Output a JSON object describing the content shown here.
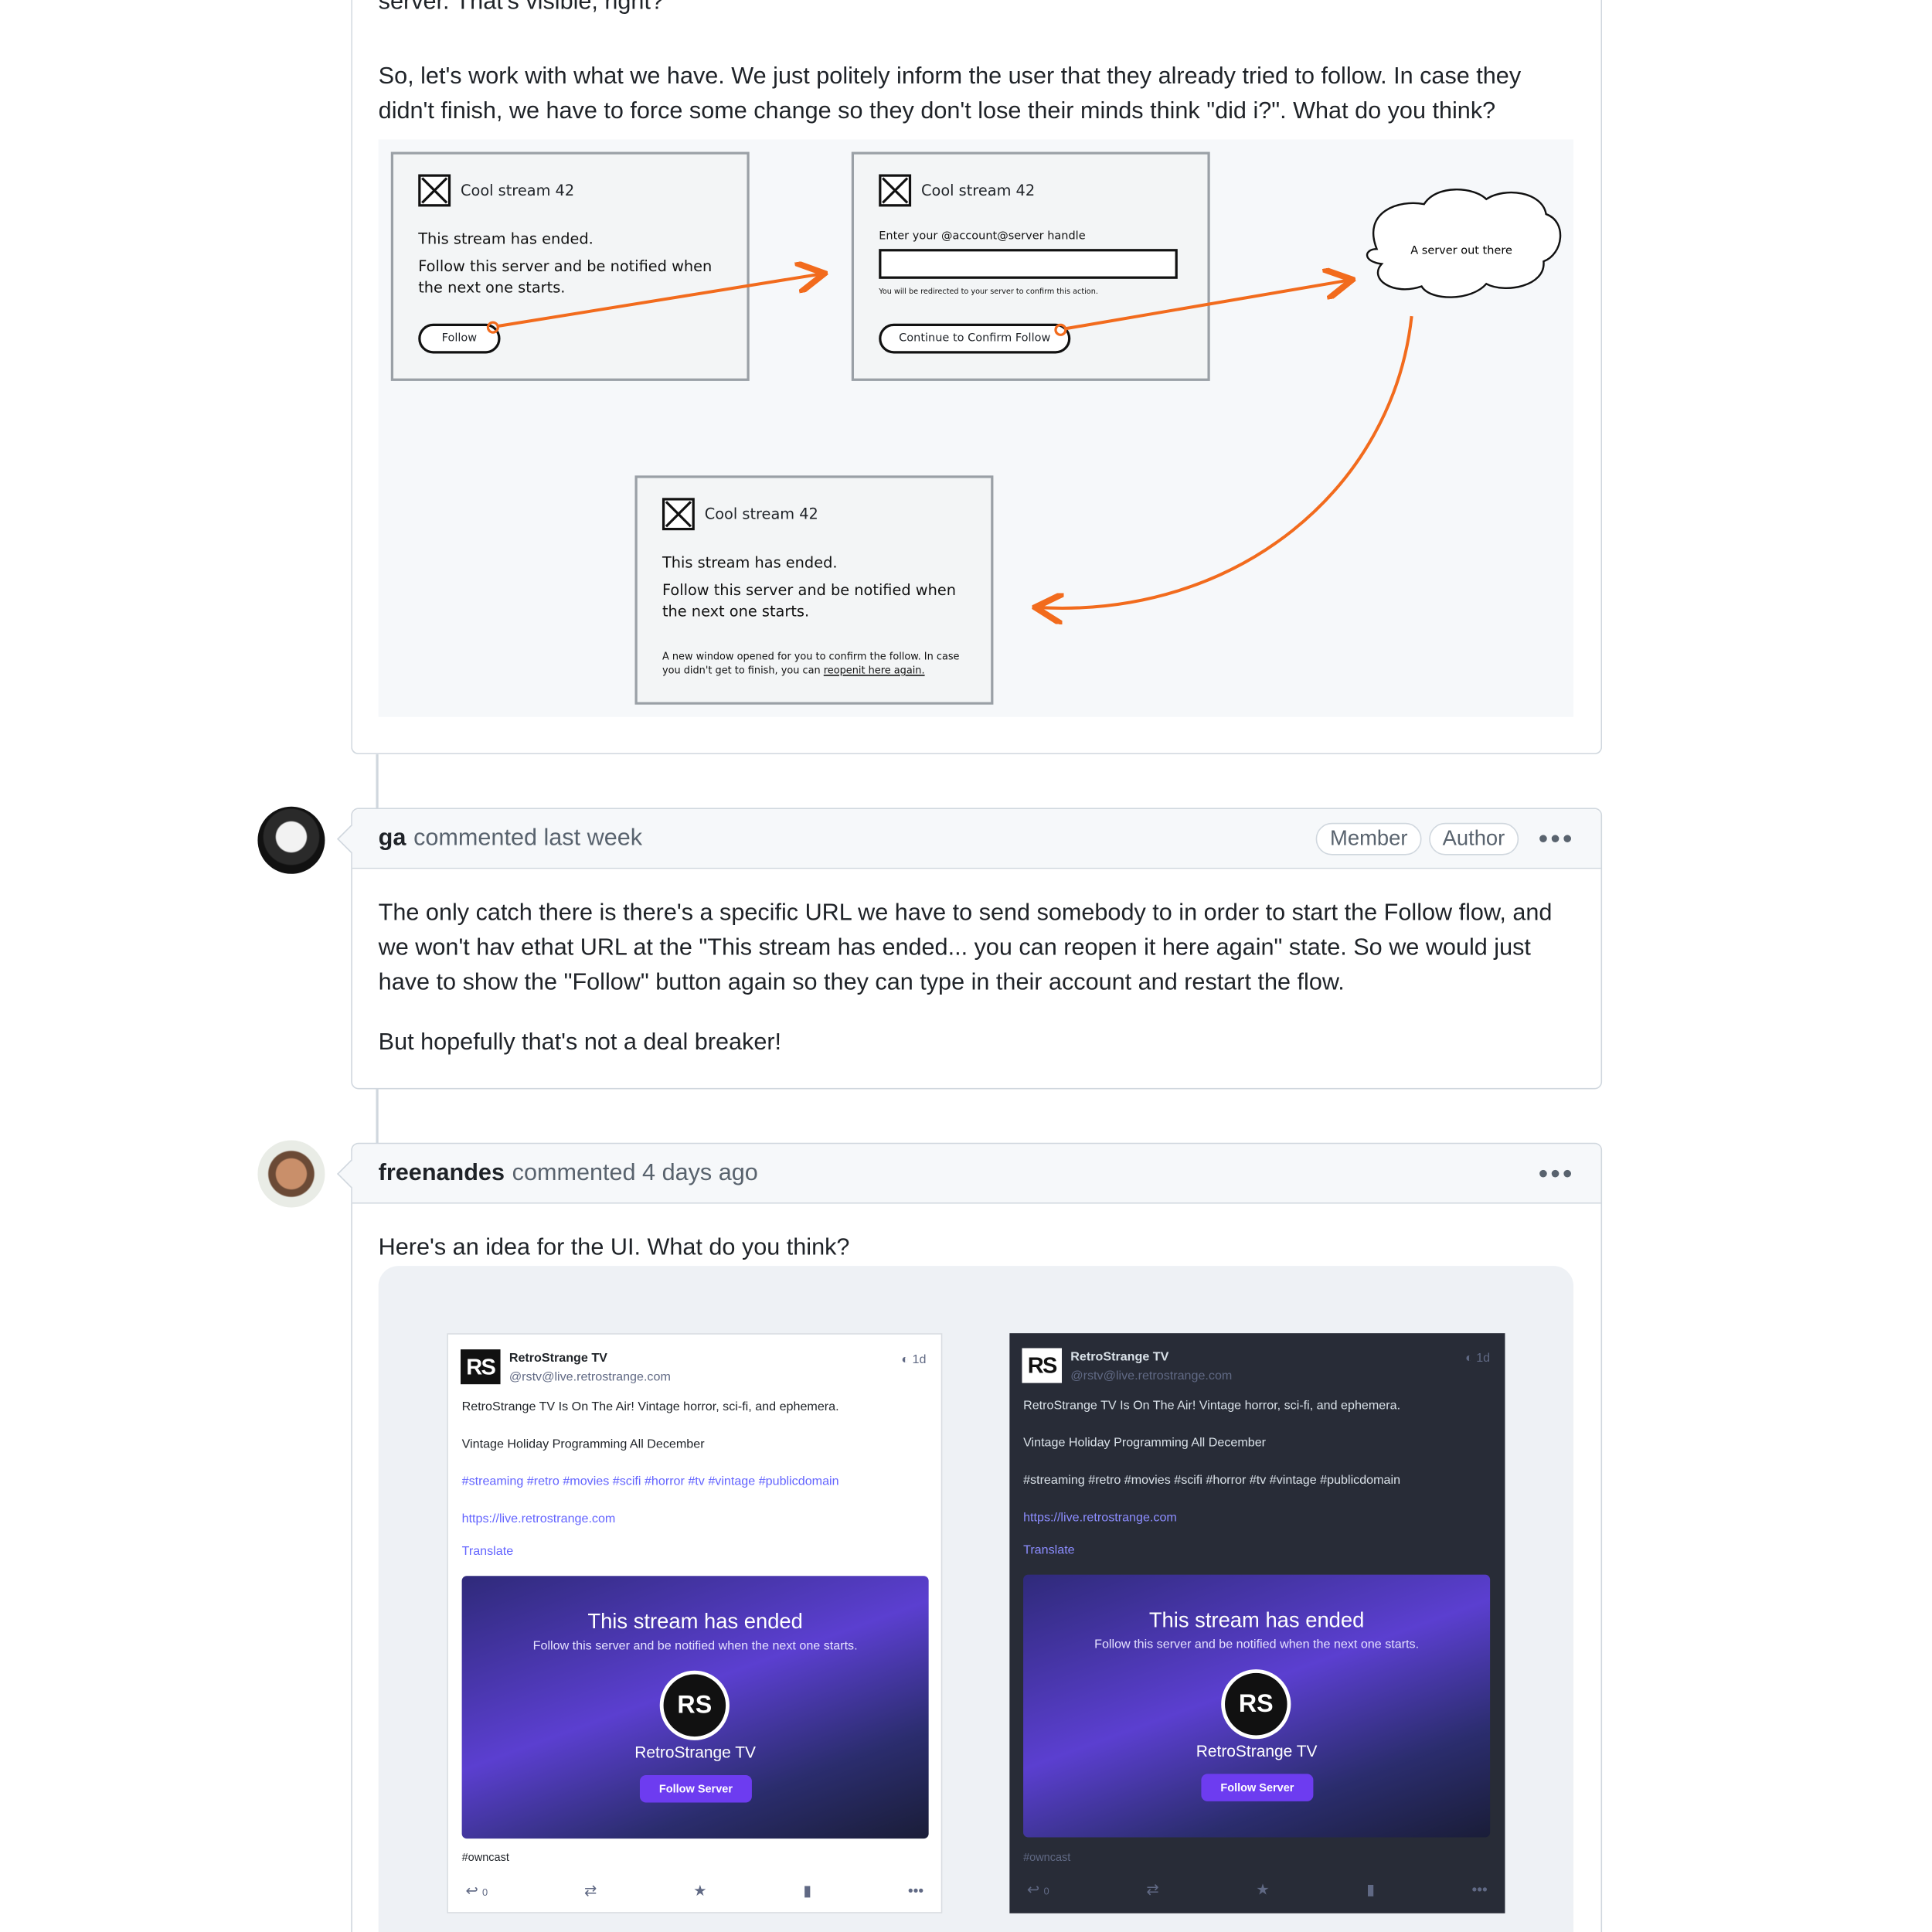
{
  "prev_comment": {
    "line_partial": "server. That's visible, right?",
    "paragraph": "So, let's work with what we have. We just politely inform the user that they already tried to follow. In case they didn't finish, we have to force some change so they don't lose their minds think \"did i?\". What do you think?"
  },
  "wireframe": {
    "box1": {
      "title": "Cool stream 42",
      "line1": "This stream has ended.",
      "line2": "Follow this server and be notified when the next one starts.",
      "button": "Follow"
    },
    "box2": {
      "title": "Cool stream 42",
      "label": "Enter your @account@server handle",
      "note": "You will be redirected to your server to confirm this action.",
      "button": "Continue to Confirm Follow"
    },
    "cloud": "A server out there",
    "box3": {
      "title": "Cool stream 42",
      "line1": "This stream has ended.",
      "line2": "Follow this server and be notified when the next one starts.",
      "note_a": "A new window opened for you to confirm the follow. In case you didn't get to finish, you can",
      "note_link": "reopenit here again."
    },
    "arrow_color": "#f26b1d"
  },
  "comment_ga": {
    "author": "ga",
    "meta": "commented last week",
    "badges": [
      "Member",
      "Author"
    ],
    "p1": "The only catch there is there's a specific URL we have to send somebody to in order to start the Follow flow, and we won't hav ethat URL at the \"This stream has ended... you can reopen it here again\" state. So we would just have to show the \"Follow\" button again so they can type in their account and restart the flow.",
    "p2": "But hopefully that's not a deal breaker!"
  },
  "comment_freenandes": {
    "author": "freenandes",
    "meta": "commented 4 days ago",
    "p1": "Here's an idea for the UI. What do you think?"
  },
  "post": {
    "logo": "RS",
    "name": "RetroStrange TV",
    "handle": "@rstv@live.retrostrange.com",
    "time": "1d",
    "line1": "RetroStrange TV Is On The Air! Vintage horror, sci-fi, and ephemera.",
    "line2": "Vintage Holiday Programming All December",
    "tags": "#streaming #retro #movies #scifi #horror #tv #vintage #publicdomain",
    "url": "https://live.retrostrange.com",
    "translate": "Translate",
    "embed_title": "This stream has ended",
    "embed_sub": "Follow this server and be notified when the next one starts.",
    "embed_name": "RetroStrange TV",
    "embed_button": "Follow Server",
    "footer_tag": "#owncast",
    "reply_count": "0"
  }
}
